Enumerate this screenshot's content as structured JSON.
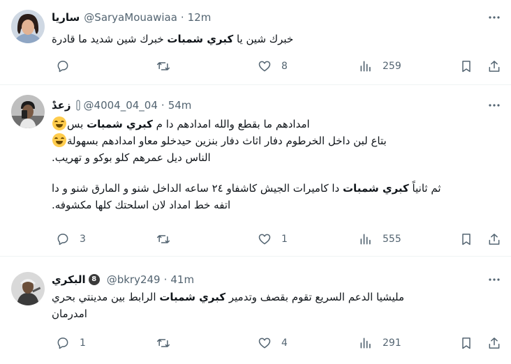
{
  "tweets": [
    {
      "display_name": "ساريا",
      "handle": "@SaryaMouawiaa",
      "separator": "·",
      "time": "12m",
      "lines": [
        {
          "pre": "خبرك شين يا ",
          "bold": "كبري شمبات",
          "post": " خبرك شين شديد ما قادرة"
        }
      ],
      "replies": "",
      "retweets": "",
      "likes": "8",
      "views": "259"
    },
    {
      "display_name": "زعدْ",
      "handle": "@4004_04_04",
      "separator": "·",
      "time": "54m",
      "lines": [
        {
          "pre": "امدادهم ما بقطع والله امدادهم دا م ",
          "bold": "كبري شمبات",
          "post": " بس"
        },
        {
          "pre": "بتاع لبن داخل الخرطوم دفار اثاث دفار بنزين حيدخلو معاو امدادهم بسهولة",
          "bold": "",
          "post": ""
        },
        {
          "pre": "الناس ديل عمرهم كلو بوكو و تهريب.",
          "bold": "",
          "post": ""
        },
        {
          "pre": "ثم ثانياً ",
          "bold": "كبري شمبات",
          "post": " دا كاميرات الجيش كاشفاو ٢٤ ساعه الداخل شنو و المارق شنو و دا"
        },
        {
          "pre": "اتفه خط امداد لان اسلحتك كلها مكشوفه.",
          "bold": "",
          "post": ""
        }
      ],
      "replies": "3",
      "retweets": "",
      "likes": "1",
      "views": "555"
    },
    {
      "display_name": "البكري",
      "badge_text": "8",
      "handle": "@bkry249",
      "separator": "·",
      "time": "41m",
      "lines": [
        {
          "pre": "مليشيا الدعم السريع تقوم بقصف وتدمير ",
          "bold": "كبري شمبات",
          "post": " الرابط بين مدينتي بحري"
        },
        {
          "pre": "امدرمان",
          "bold": "",
          "post": ""
        }
      ],
      "replies": "1",
      "retweets": "",
      "likes": "4",
      "views": "291"
    }
  ]
}
